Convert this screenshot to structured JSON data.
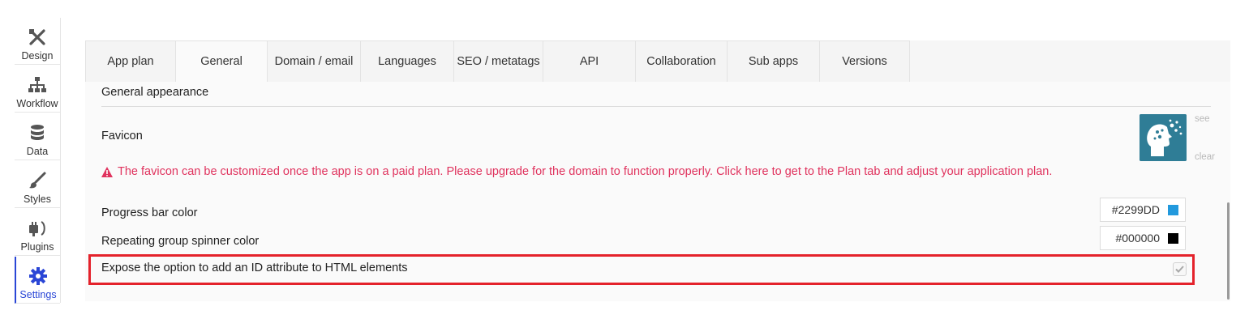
{
  "sidebar": {
    "items": [
      {
        "label": "Design",
        "icon": "design-tools-icon"
      },
      {
        "label": "Workflow",
        "icon": "workflow-icon"
      },
      {
        "label": "Data",
        "icon": "database-icon"
      },
      {
        "label": "Styles",
        "icon": "brush-icon"
      },
      {
        "label": "Plugins",
        "icon": "plug-icon"
      },
      {
        "label": "Settings",
        "icon": "gear-icon",
        "active": true
      }
    ]
  },
  "tabs": [
    {
      "label": "App plan"
    },
    {
      "label": "General",
      "active": true
    },
    {
      "label": "Domain / email"
    },
    {
      "label": "Languages"
    },
    {
      "label": "SEO / metatags"
    },
    {
      "label": "API"
    },
    {
      "label": "Collaboration"
    },
    {
      "label": "Sub apps"
    },
    {
      "label": "Versions"
    }
  ],
  "general": {
    "section_title": "General appearance",
    "favicon": {
      "label": "Favicon",
      "see_label": "see",
      "clear_label": "clear"
    },
    "warning": {
      "text": "The favicon can be customized once the app is on a paid plan. Please upgrade for the domain to function properly. Click here to get to the Plan tab and adjust your application plan.",
      "color": "#E0335E"
    },
    "progress_bar": {
      "label": "Progress bar color",
      "value": "#2299DD",
      "swatch": "#2299DD"
    },
    "spinner": {
      "label": "Repeating group spinner color",
      "value": "#000000",
      "swatch": "#000000"
    },
    "expose_id": {
      "label": "Expose the option to add an ID attribute to HTML elements",
      "checked": true
    }
  },
  "colors": {
    "accent": "#2A46D6",
    "highlight": "#E4222B"
  }
}
